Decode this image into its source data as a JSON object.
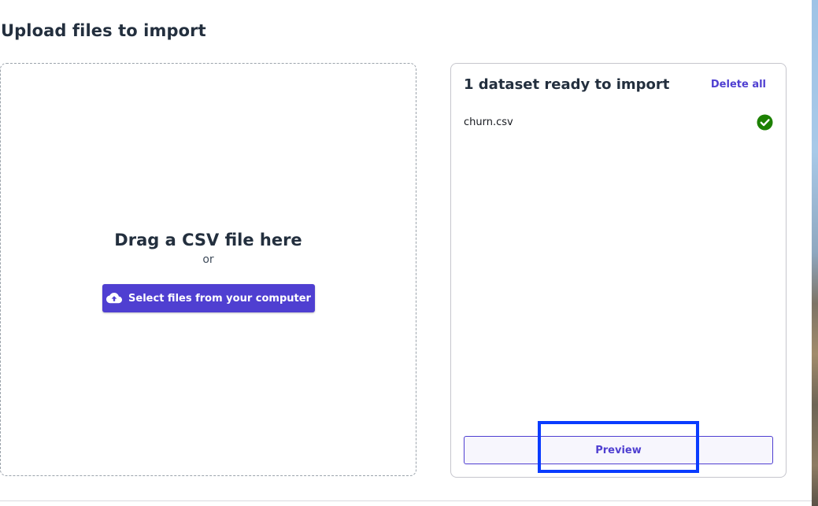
{
  "page": {
    "title": "Upload files to import"
  },
  "dropzone": {
    "title": "Drag a CSV file here",
    "or_text": "or",
    "select_button_label": "Select files from your computer",
    "select_button_icon": "cloud-upload-icon"
  },
  "panel": {
    "title": "1 dataset ready to import",
    "delete_all_label": "Delete all",
    "files": [
      {
        "name": "churn.csv",
        "status_icon": "check-circle-icon",
        "status_color": "#1d8102"
      }
    ],
    "preview_button_label": "Preview"
  },
  "colors": {
    "accent": "#4f3fd1",
    "highlight": "#0a3cff",
    "success": "#1d8102"
  }
}
